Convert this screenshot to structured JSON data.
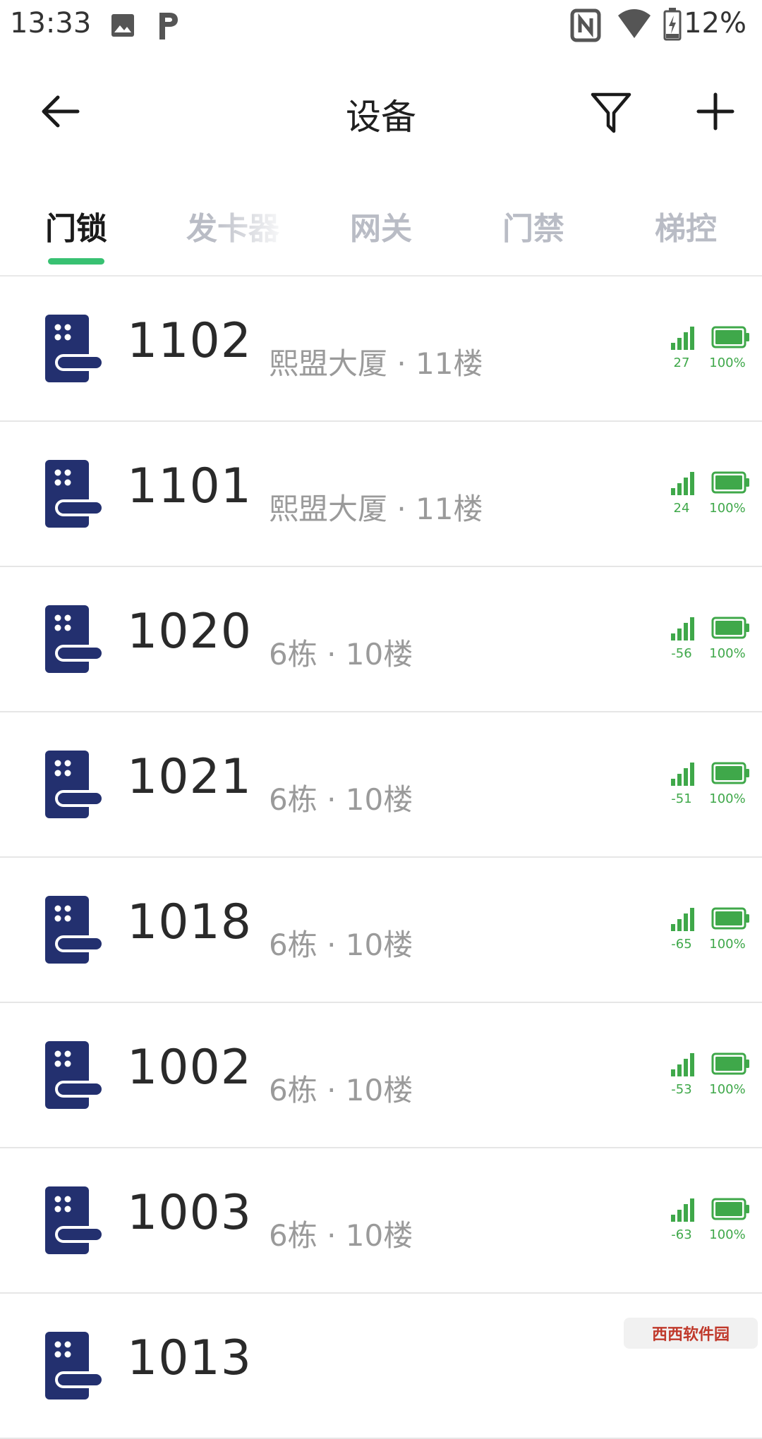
{
  "status_bar": {
    "time": "13:33",
    "battery_percent": "12%",
    "icons": [
      "image-icon",
      "parking-app-icon",
      "nfc-icon",
      "wifi-icon",
      "battery-charging-icon"
    ]
  },
  "app_bar": {
    "title": "设备",
    "back_icon": "arrow-left-icon",
    "filter_icon": "filter-icon",
    "add_icon": "plus-icon"
  },
  "tabs": [
    {
      "label": "门锁",
      "active": true
    },
    {
      "label": "发卡器",
      "active": false
    },
    {
      "label": "网关",
      "active": false
    },
    {
      "label": "门禁",
      "active": false
    },
    {
      "label": "梯控",
      "active": false
    }
  ],
  "colors": {
    "accent_green": "#38c172",
    "status_green": "#3fa84a",
    "lock_icon_navy": "#23306f"
  },
  "devices": [
    {
      "number": "1102",
      "location": "熙盟大厦 · 11楼",
      "signal": "27",
      "battery": "100%"
    },
    {
      "number": "1101",
      "location": "熙盟大厦 · 11楼",
      "signal": "24",
      "battery": "100%"
    },
    {
      "number": "1020",
      "location": "6栋 · 10楼",
      "signal": "-56",
      "battery": "100%"
    },
    {
      "number": "1021",
      "location": "6栋 · 10楼",
      "signal": "-51",
      "battery": "100%"
    },
    {
      "number": "1018",
      "location": "6栋 · 10楼",
      "signal": "-65",
      "battery": "100%"
    },
    {
      "number": "1002",
      "location": "6栋 · 10楼",
      "signal": "-53",
      "battery": "100%"
    },
    {
      "number": "1003",
      "location": "6栋 · 10楼",
      "signal": "-63",
      "battery": "100%"
    },
    {
      "number": "1013",
      "location": "",
      "signal": "",
      "battery": ""
    }
  ],
  "watermark": "西西软件园"
}
